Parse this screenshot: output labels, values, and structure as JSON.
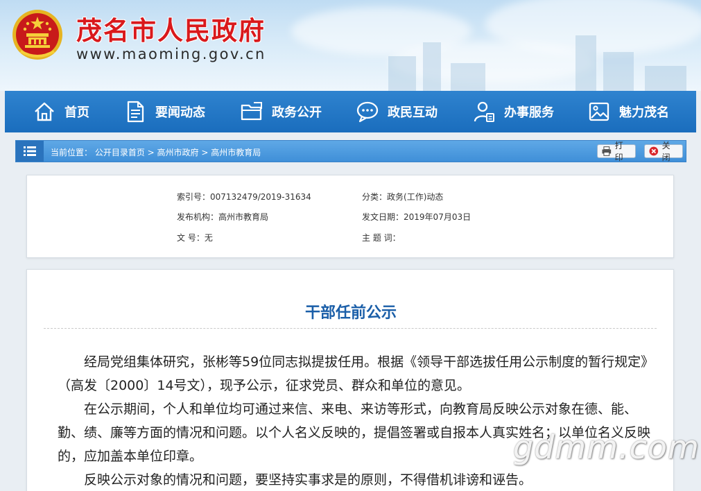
{
  "site": {
    "title": "茂名市人民政府",
    "url": "www.maoming.gov.cn"
  },
  "nav": {
    "items": [
      {
        "label": "首页",
        "icon": "home-icon"
      },
      {
        "label": "要闻动态",
        "icon": "document-icon"
      },
      {
        "label": "政务公开",
        "icon": "folder-icon"
      },
      {
        "label": "政民互动",
        "icon": "chat-icon"
      },
      {
        "label": "办事服务",
        "icon": "user-service-icon"
      },
      {
        "label": "魅力茂名",
        "icon": "image-icon"
      }
    ]
  },
  "breadcrumb": {
    "prefix": "当前位置：",
    "items": [
      "公开目录首页",
      "高州市政府",
      "高州市教育局"
    ],
    "separator": " > "
  },
  "toolbar": {
    "print_label": "打印",
    "close_label": "关闭"
  },
  "meta": {
    "index_label": "索引号：",
    "index_value": "007132479/2019-31634",
    "category_label": "分类：",
    "category_value": "政务(工作)动态",
    "publisher_label": "发布机构：",
    "publisher_value": "高州市教育局",
    "date_label": "发文日期：",
    "date_value": "2019年07月03日",
    "docno_label": "文 号：",
    "docno_value": "无",
    "subject_label": "主 题 词：",
    "subject_value": ""
  },
  "article": {
    "title": "干部任前公示",
    "paragraphs": [
      "经局党组集体研究，张彬等59位同志拟提拔任用。根据《领导干部选拔任用公示制度的暂行规定》（高发〔2000〕14号文），现予公示，征求党员、群众和单位的意见。",
      "在公示期间，个人和单位均可通过来信、来电、来访等形式，向教育局反映公示对象在德、能、勤、绩、廉等方面的情况和问题。以个人名义反映的，提倡签署或自报本人真实姓名；以单位名义反映的，应加盖本单位印章。",
      "反映公示对象的情况和问题，要坚持实事求是的原则，不得借机诽谤和诬告。"
    ]
  },
  "watermark": "gdmm.com",
  "colors": {
    "title_red": "#d9191c",
    "nav_blue": "#1a6dbd",
    "article_title_blue": "#1a5ea8"
  }
}
